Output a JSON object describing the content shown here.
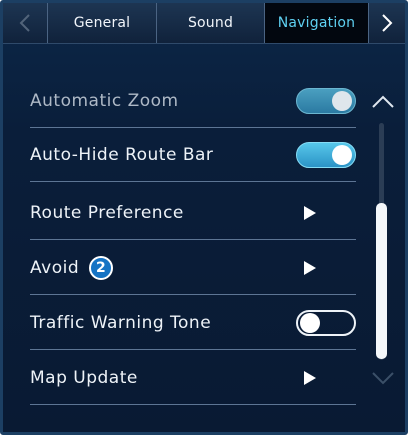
{
  "tabs": {
    "prev_icon": "chevron-left-icon",
    "next_icon": "chevron-right-icon",
    "items": [
      {
        "label": "General",
        "active": false
      },
      {
        "label": "Sound",
        "active": false
      },
      {
        "label": "Navigation",
        "active": true
      }
    ]
  },
  "settings": {
    "automatic_zoom": {
      "label": "Automatic Zoom",
      "state": "on",
      "enabled": false
    },
    "auto_hide_route_bar": {
      "label": "Auto-Hide Route Bar",
      "state": "on"
    },
    "route_preference": {
      "label": "Route Preference",
      "icon": "play-arrow-icon"
    },
    "avoid": {
      "label": "Avoid",
      "badge": "2",
      "icon": "play-arrow-icon"
    },
    "traffic_warning_tone": {
      "label": "Traffic Warning Tone",
      "state": "off"
    },
    "map_update": {
      "label": "Map Update",
      "icon": "play-arrow-icon"
    }
  },
  "scroll": {
    "up_icon": "chevron-up-icon",
    "down_icon": "chevron-down-icon"
  },
  "colors": {
    "accent": "#5fd1f2",
    "toggle_on": "#3aaedb",
    "badge": "#1573c4",
    "background": "#0a1e3a"
  }
}
